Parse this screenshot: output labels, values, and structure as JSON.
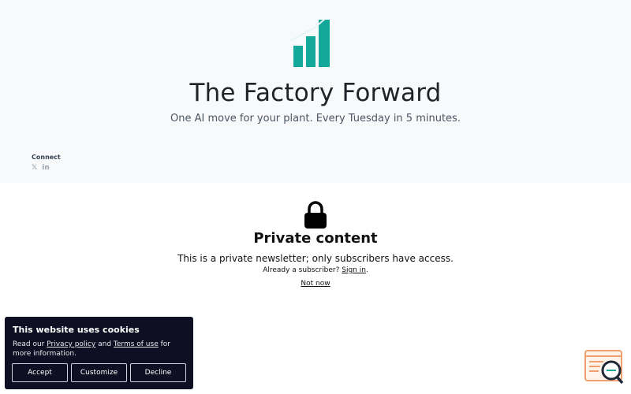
{
  "site": {
    "title": "The Factory Forward",
    "tagline": "One AI move for your plant. Every Tuesday in 5 minutes.",
    "accent_color": "#14a89a"
  },
  "connect": {
    "label": "Connect",
    "icons": [
      {
        "name": "x-twitter-icon",
        "glyph": "𝕏"
      },
      {
        "name": "linkedin-icon",
        "glyph": "in"
      }
    ]
  },
  "private": {
    "icon": "lock-icon",
    "title": "Private content",
    "description": "This is a private newsletter; only subscribers have access.",
    "already_prefix": "Already a subscriber?",
    "sign_in": "Sign in",
    "already_suffix": ".",
    "not_now": "Not now"
  },
  "cookie_banner": {
    "title": "This website uses cookies",
    "text_prefix": "Read our",
    "privacy_link": "Privacy policy",
    "and": "and",
    "terms_link": "Terms of use",
    "text_suffix": "for more information.",
    "buttons": {
      "accept": "Accept",
      "customize": "Customize",
      "decline": "Decline"
    },
    "background": "#0f0f23"
  },
  "chat_widget": {
    "icon": "search-chat-icon",
    "accent": "#f0a070"
  }
}
